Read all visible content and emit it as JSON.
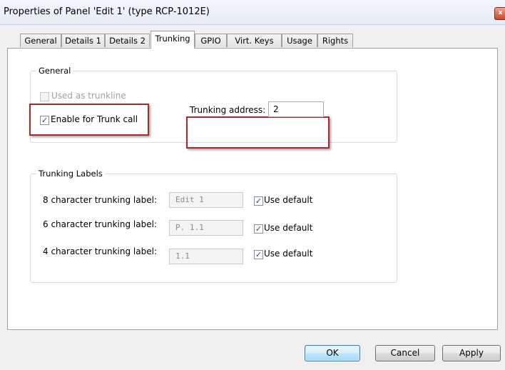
{
  "window": {
    "title": "Properties of Panel 'Edit 1' (type RCP-1012E)"
  },
  "tabs": [
    {
      "label": "General"
    },
    {
      "label": "Details 1"
    },
    {
      "label": "Details 2"
    },
    {
      "label": "Trunking",
      "active": true
    },
    {
      "label": "GPIO"
    },
    {
      "label": "Virt. Keys"
    },
    {
      "label": "Usage"
    },
    {
      "label": "Rights"
    }
  ],
  "general_group": {
    "legend": "General",
    "used_as_trunkline": {
      "label": "Used as trunkline",
      "checked": false,
      "enabled": false
    },
    "enable_trunk_call": {
      "label": "Enable for Trunk call",
      "checked": true
    },
    "trunking_address": {
      "label": "Trunking address:",
      "value": "2"
    }
  },
  "trunking_labels_group": {
    "legend": "Trunking Labels",
    "rows": [
      {
        "label": "8 character trunking label:",
        "value": "Edit 1",
        "use_default_label": "Use default",
        "use_default_checked": true
      },
      {
        "label": "6 character trunking label:",
        "value": "P. 1.1",
        "use_default_label": "Use default",
        "use_default_checked": true
      },
      {
        "label": "4 character trunking label:",
        "value": "1.1",
        "use_default_label": "Use default",
        "use_default_checked": true
      }
    ]
  },
  "buttons": {
    "ok": "OK",
    "cancel": "Cancel",
    "apply": "Apply"
  },
  "glyphs": {
    "check": "✓",
    "close": "x"
  },
  "colors": {
    "highlight_box": "#b0272a",
    "checkmark": "#224c8a"
  }
}
